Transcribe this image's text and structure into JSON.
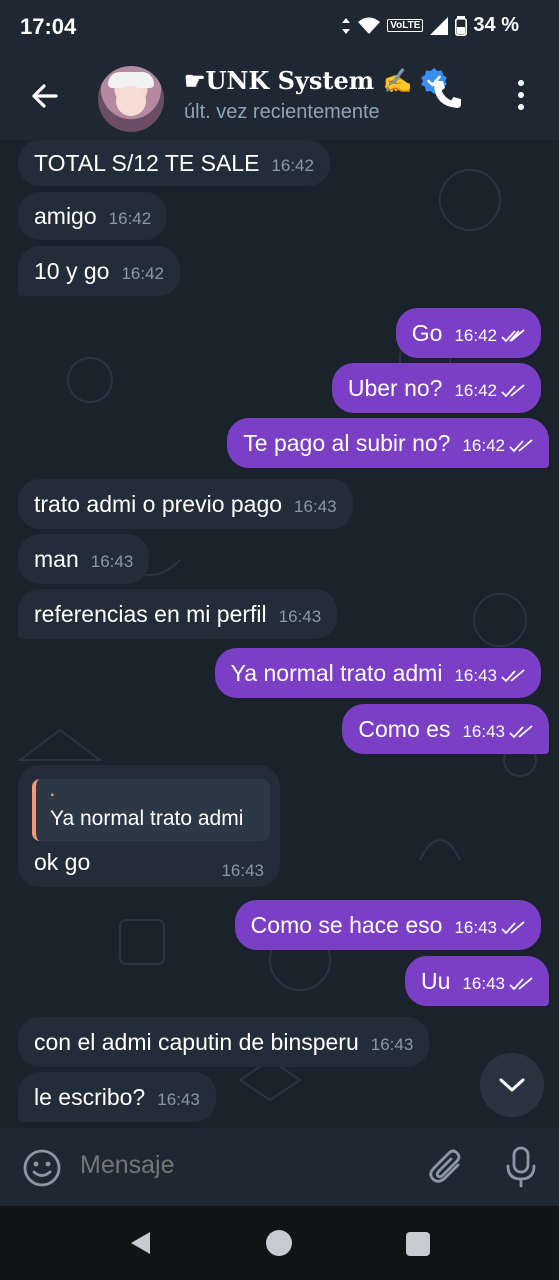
{
  "status_bar": {
    "time": "17:04",
    "volte": "VoLTE",
    "battery": "34 %"
  },
  "header": {
    "title": "☛UNK System ✍",
    "subtitle": "últ. vez recientemente"
  },
  "messages": [
    {
      "dir": "in",
      "text": "TOTAL S/12 TE SALE",
      "time": "16:42"
    },
    {
      "dir": "in",
      "text": "amigo",
      "time": "16:42"
    },
    {
      "dir": "in",
      "text": "10 y go",
      "time": "16:42"
    },
    {
      "dir": "out",
      "text": "Go",
      "time": "16:42"
    },
    {
      "dir": "out",
      "text": "Uber no?",
      "time": "16:42"
    },
    {
      "dir": "out",
      "text": "Te pago al subir no?",
      "time": "16:42"
    },
    {
      "dir": "in",
      "text": "trato admi o previo pago",
      "time": "16:43"
    },
    {
      "dir": "in",
      "text": "man",
      "time": "16:43"
    },
    {
      "dir": "in",
      "text": "referencias en mi perfil",
      "time": "16:43"
    },
    {
      "dir": "out",
      "text": "Ya normal trato admi",
      "time": "16:43"
    },
    {
      "dir": "out",
      "text": "Como es",
      "time": "16:43"
    },
    {
      "dir": "out",
      "text": "Como se hace eso",
      "time": "16:43"
    },
    {
      "dir": "out",
      "text": "Uu",
      "time": "16:43"
    },
    {
      "dir": "in",
      "text": "con el admi caputin de binsperu",
      "time": "16:43"
    },
    {
      "dir": "in",
      "text": "le escribo?",
      "time": "16:43"
    }
  ],
  "reply_message": {
    "quoted_name": ".",
    "quoted_text": "Ya normal trato admi",
    "text": "ok go",
    "time": "16:43"
  },
  "input": {
    "placeholder": "Mensaje"
  },
  "colors": {
    "outgoing": "#7b3fc6",
    "incoming": "#232d39",
    "header": "#1f2733"
  },
  "icons": [
    "back-arrow-icon",
    "verified-badge-icon",
    "phone-icon",
    "more-vert-icon",
    "double-check-icon",
    "chevron-down-icon",
    "emoji-icon",
    "paperclip-icon",
    "microphone-icon"
  ]
}
